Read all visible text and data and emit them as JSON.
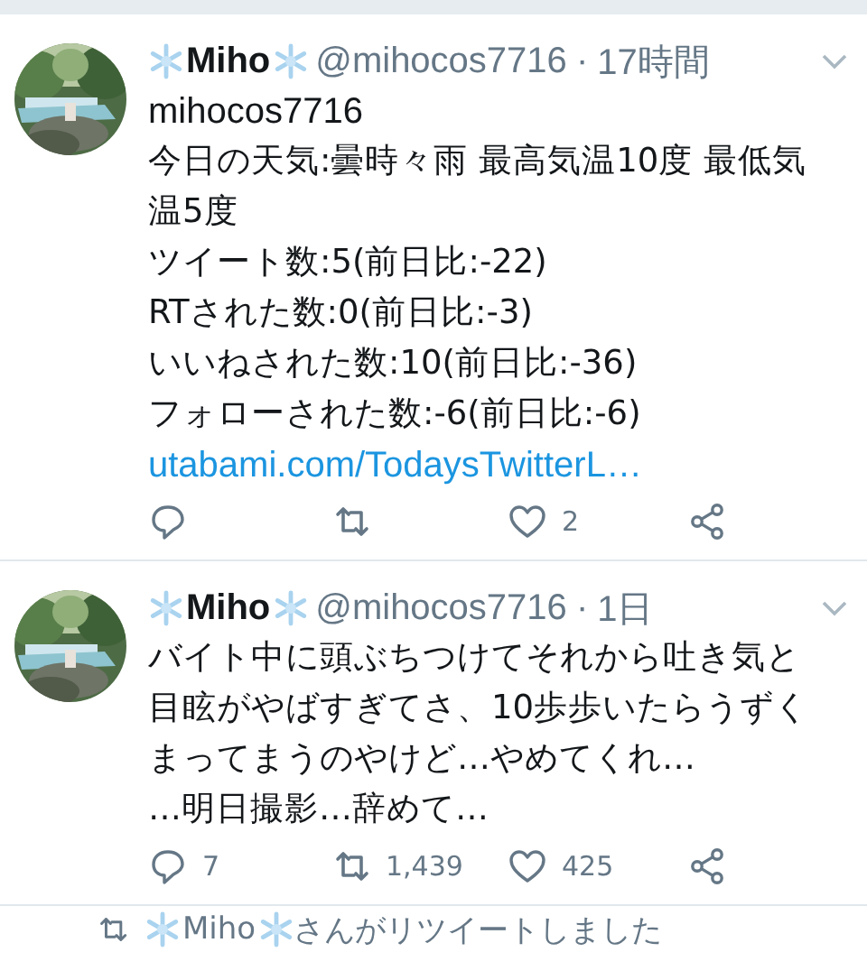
{
  "tweets": [
    {
      "name": "Miho",
      "handle": "@mihocos7716",
      "separator": "·",
      "time": "17時間",
      "lines": [
        "mihocos7716",
        "今日の天気:曇時々雨 最高気温10度 最低気",
        "温5度",
        "ツイート数:5(前日比:-22)",
        "RTされた数:0(前日比:-3)",
        "いいねされた数:10(前日比:-36)",
        "フォローされた数:-6(前日比:-6)"
      ],
      "link": "utabami.com/TodaysTwitterL…",
      "likes": "2"
    },
    {
      "name": "Miho",
      "handle": "@mihocos7716",
      "separator": "·",
      "time": "1日",
      "lines": [
        "バイト中に頭ぶちつけてそれから吐き気と",
        "目眩がやばすぎてさ、10歩歩いたらうずく",
        "まってまうのやけど…やめてくれ…",
        "…明日撮影…辞めて…"
      ],
      "replies": "7",
      "retweets": "1,439",
      "likes": "425"
    }
  ],
  "retweet_notice": {
    "name": "Miho",
    "text": "さんがリツイートしました"
  }
}
